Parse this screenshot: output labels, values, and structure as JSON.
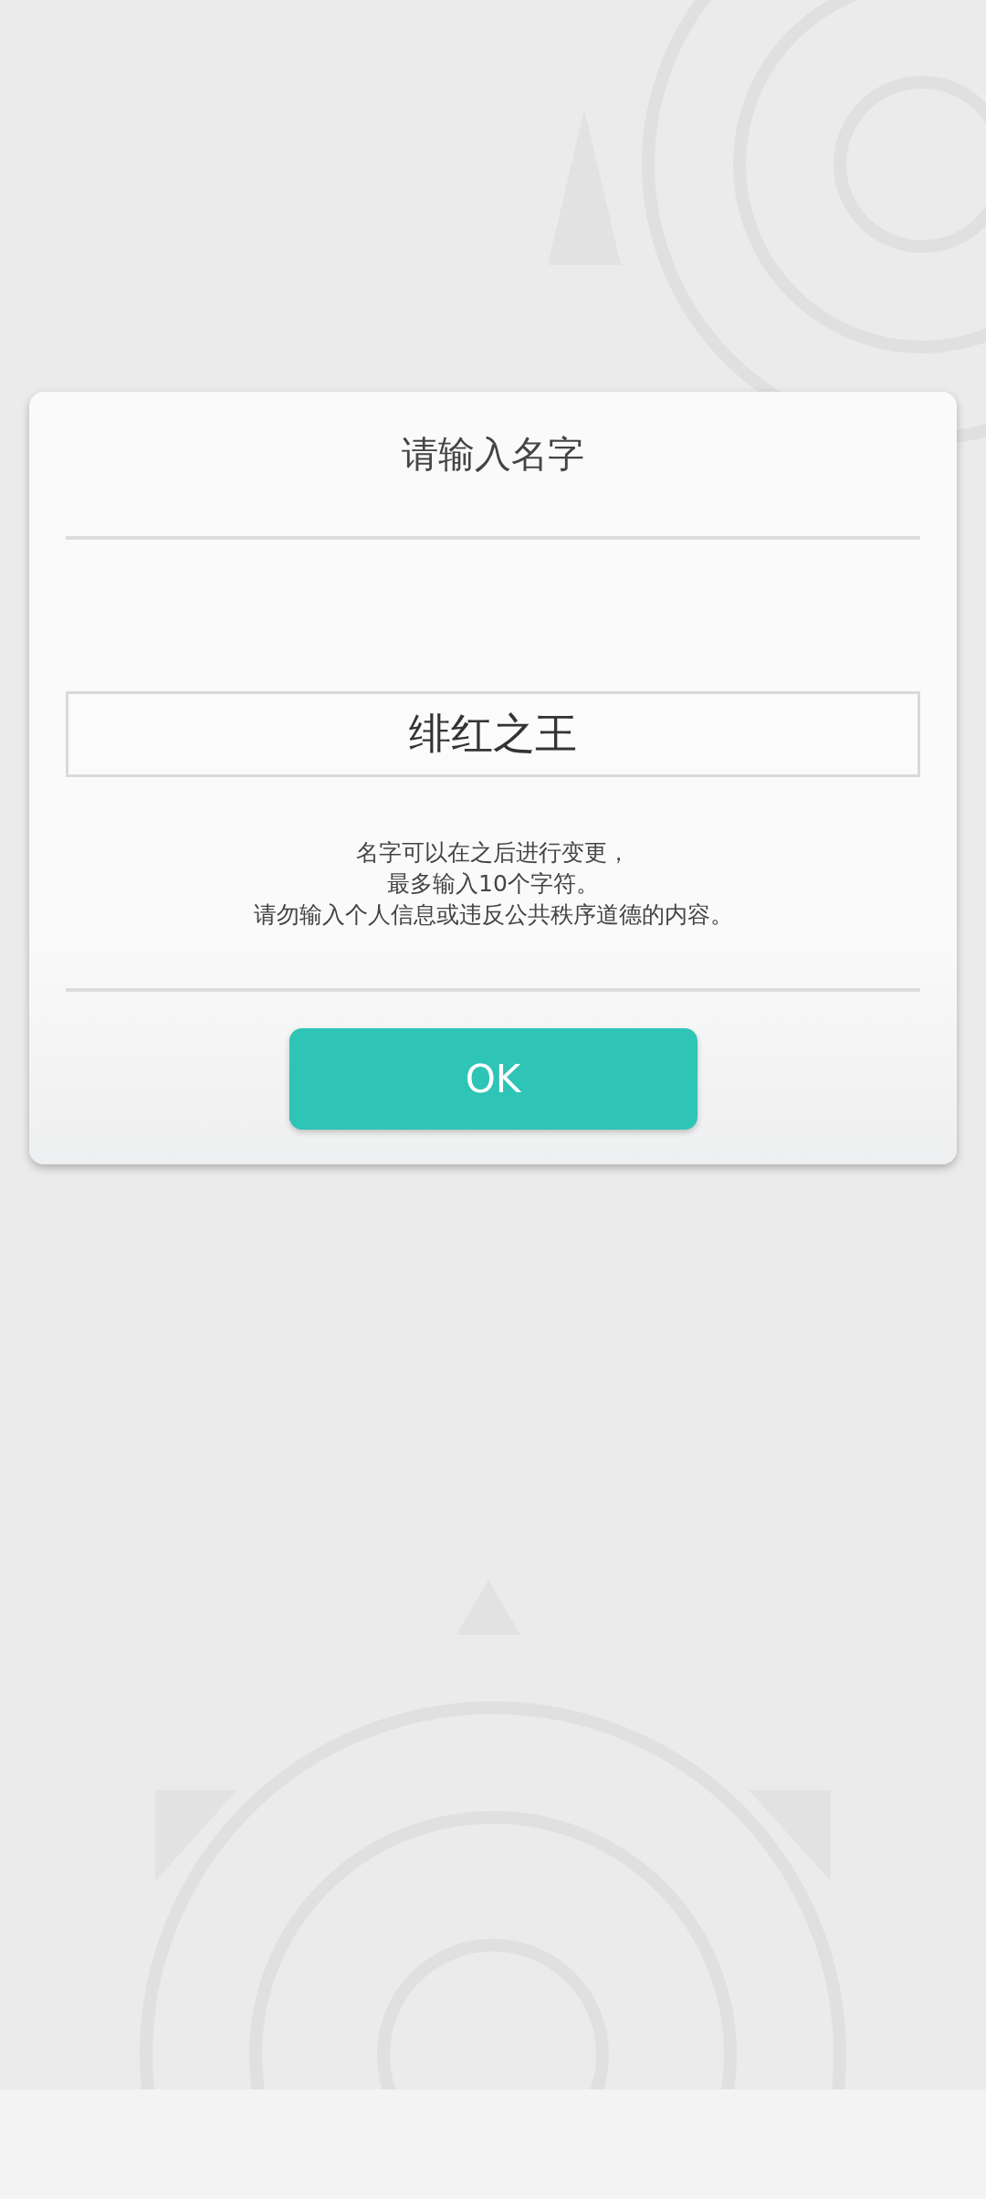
{
  "dialog": {
    "title": "请输入名字",
    "name_field": {
      "value": "绯红之王"
    },
    "hint_lines": [
      "名字可以在之后进行变更，",
      "最多输入10个字符。",
      "请勿输入个人信息或违反公共秩序道德的内容。"
    ],
    "buttons": [
      {
        "label": "OK",
        "kind": "primary"
      }
    ]
  }
}
